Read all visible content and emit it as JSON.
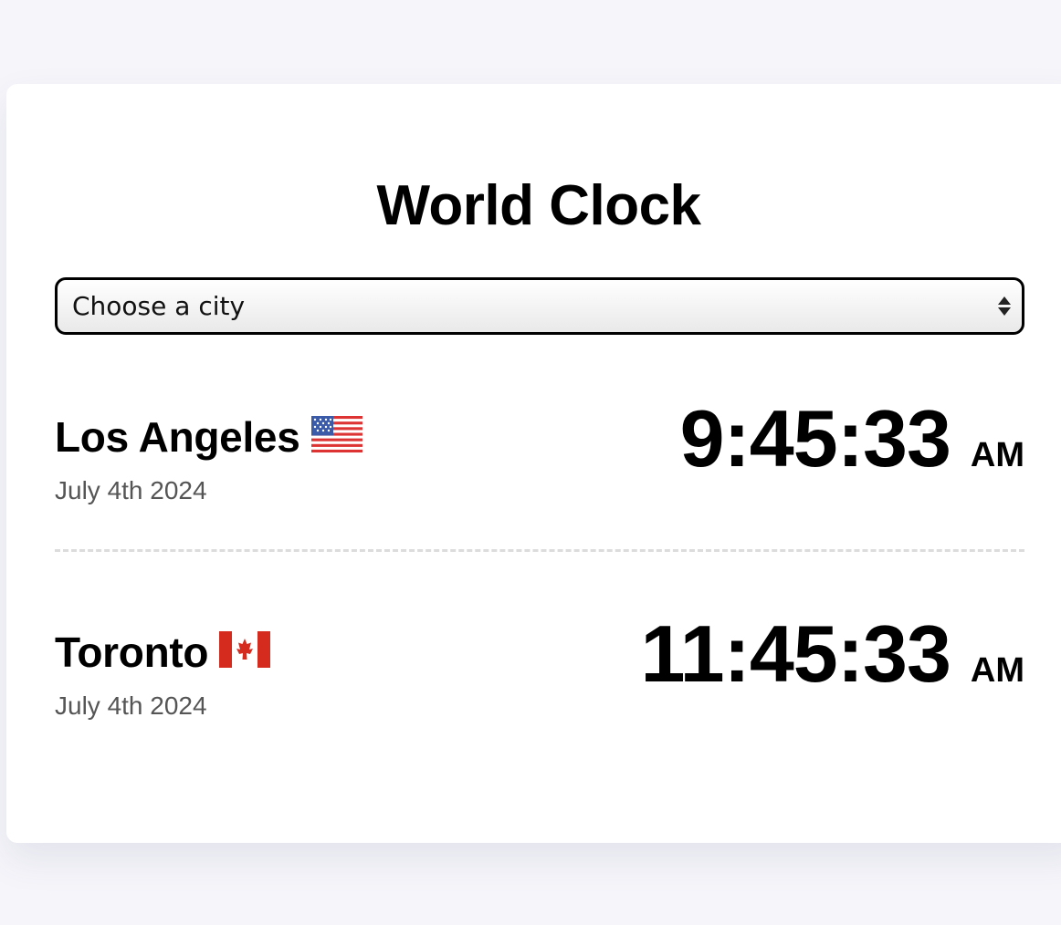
{
  "app": {
    "title": "World Clock"
  },
  "city_select": {
    "value": "Choose a city"
  },
  "cities": [
    {
      "name": "Los Angeles",
      "flag": "us-flag-icon",
      "date": "July 4th 2024",
      "time": "9:45:33",
      "ampm": "AM"
    },
    {
      "name": "Toronto",
      "flag": "canada-flag-icon",
      "date": "July 4th 2024",
      "time": "11:45:33",
      "ampm": "AM"
    }
  ],
  "colors": {
    "background": "#f5f5fa",
    "card": "#ffffff",
    "date_text": "#555555",
    "divider": "#dcdcdc"
  }
}
